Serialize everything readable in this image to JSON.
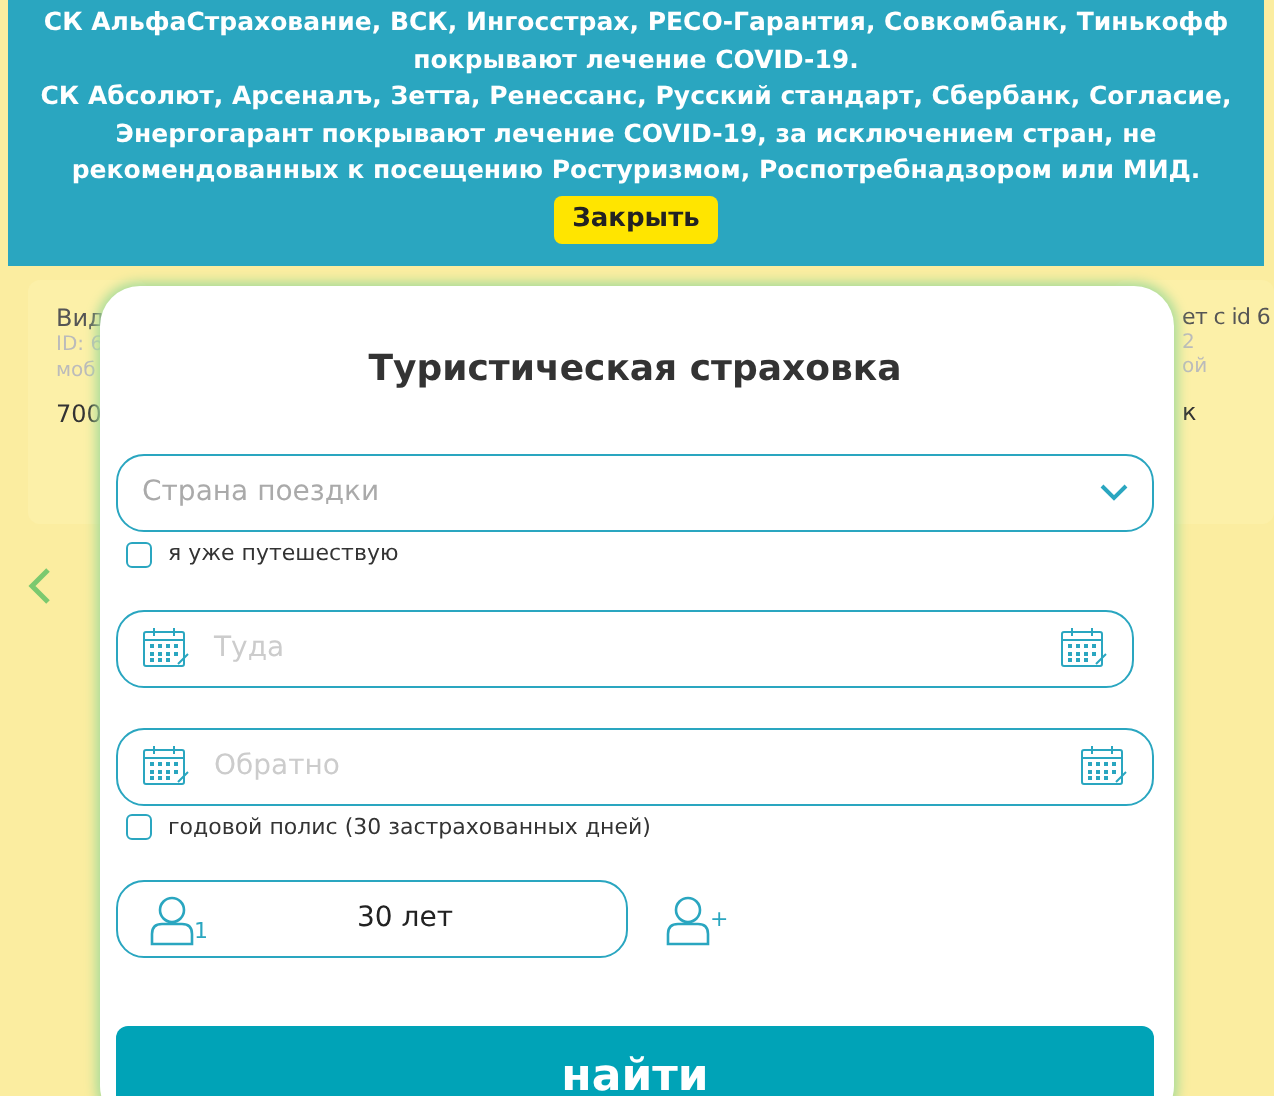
{
  "background": {
    "left_card": [
      {
        "text": "Вид",
        "kind": "title"
      },
      {
        "text": "ID: 6",
        "kind": "meta"
      },
      {
        "text": "моб",
        "kind": "meta"
      },
      {
        "text": "700",
        "kind": "price"
      }
    ],
    "right_card": [
      {
        "text": "ет с id 6",
        "kind": "title"
      },
      {
        "text": "2",
        "kind": "meta"
      },
      {
        "text": "ой",
        "kind": "meta"
      },
      {
        "text": "к",
        "kind": "price"
      }
    ]
  },
  "notice": {
    "paragraphs": [
      "СК АльфаСтрахование, ВСК, Ингосстрах, РЕСО-Гарантия, Совкомбанк, Тинькофф покрывают лечение COVID-19.",
      "СК Абсолют, Арсеналъ, Зетта, Ренессанс, Русский стандарт, Сбербанк, Согласие, Энергогарант покрывают лечение COVID-19, за исключением стран, не рекомендованных к посещению Ростуризмом, Роспотребнадзором или МИД."
    ],
    "close_button": "Закрыть"
  },
  "modal": {
    "title": "Туристическая страховка",
    "country": {
      "placeholder": "Страна поездки"
    },
    "already_travelling": {
      "label": "я уже путешествую",
      "checked": false
    },
    "depart": {
      "placeholder": "Туда"
    },
    "return": {
      "placeholder": "Обратно"
    },
    "annual_policy": {
      "label": "годовой полис (30 застрахованных дней)",
      "checked": false
    },
    "traveler": {
      "count": "1",
      "age": "30 лет"
    },
    "add_traveler": "+",
    "search_button": "найти"
  }
}
